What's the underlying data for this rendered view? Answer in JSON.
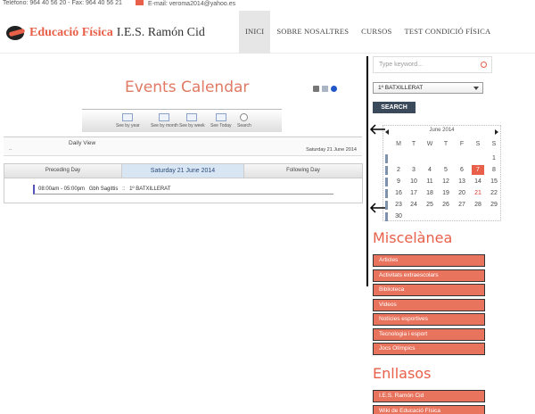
{
  "topbar": {
    "phone": "Telèfono: 964 40 56 20 - Fax: 964 40 56 21",
    "email": "E-mail: veroma2014@yahoo.es"
  },
  "header": {
    "logo_bold": "Educació Física",
    "logo_rest": "I.E.S. Ramón Cid",
    "nav": [
      "INICI",
      "SOBRE NOSALTRES",
      "CURSOS",
      "TEST CONDICIÓ FÍSICA"
    ],
    "active_nav": "INICI"
  },
  "events": {
    "title": "Events Calendar",
    "toolbar": [
      "See by year",
      "See by month",
      "See by week",
      "See Today",
      "Search"
    ],
    "view_label": "Daily View",
    "dots": "..",
    "date_text": "Saturday 21 June 2014",
    "prev_day": "Preceding Day",
    "current_day": "Saturday 21 June 2014",
    "next_day": "Following Day",
    "event": {
      "time": "08:00am - 05:00pm",
      "name": "Gbh Sagittis",
      "sep": "::",
      "category": "1º BATXILLERAT"
    }
  },
  "sidebar": {
    "keyword_placeholder": "Type keyword...",
    "select_value": "1º BATXILLERAT",
    "search_button": "SEARCH",
    "calendar": {
      "month": "June 2014",
      "day_names": [
        "M",
        "T",
        "W",
        "T",
        "F",
        "S",
        "S"
      ],
      "weeks": [
        [
          "",
          "",
          "",
          "",
          "",
          "",
          "1"
        ],
        [
          "2",
          "3",
          "4",
          "5",
          "6",
          "7",
          "8"
        ],
        [
          "9",
          "10",
          "11",
          "12",
          "13",
          "14",
          "15"
        ],
        [
          "16",
          "17",
          "18",
          "19",
          "20",
          "21",
          "22"
        ],
        [
          "23",
          "24",
          "25",
          "26",
          "27",
          "28",
          "29"
        ],
        [
          "30",
          "",
          "",
          "",
          "",
          "",
          ""
        ]
      ],
      "today": "7",
      "highlight": "21"
    },
    "miscellanea_title": "Miscelànea",
    "miscellanea": [
      "Articles",
      "Activitats extraescolars",
      "Biblioteca",
      "Videos",
      "Notícies esportives",
      "Tecnologia i esport",
      "Jocs Olímpics"
    ],
    "links_title": "Enllasos",
    "links": [
      "I.E.S. Ramón Cid",
      "Wiki de Educació Física"
    ],
    "accent": "#e8604a"
  }
}
